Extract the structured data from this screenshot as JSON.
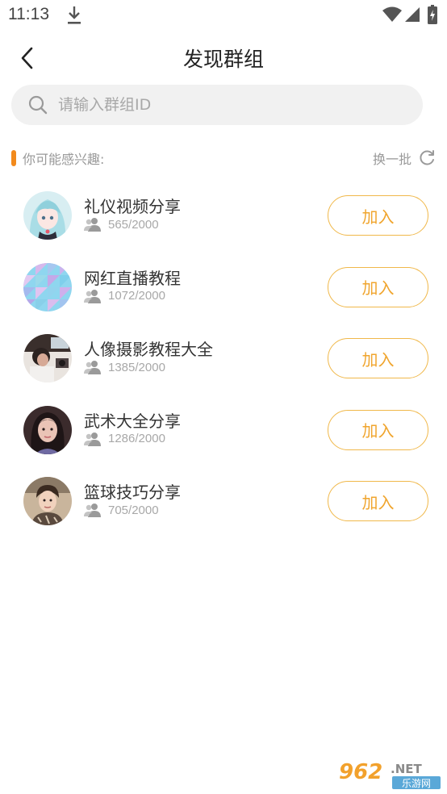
{
  "status_bar": {
    "time": "11:13"
  },
  "nav": {
    "title": "发现群组",
    "back_icon": "chevron-left-icon"
  },
  "search": {
    "placeholder": "请输入群组ID",
    "value": ""
  },
  "section": {
    "title": "你可能感兴趣:",
    "refresh_label": "换一批",
    "accent_color": "#f28a1c"
  },
  "groups": [
    {
      "name": "礼仪视频分享",
      "members": "565/2000",
      "join_label": "加入"
    },
    {
      "name": "网红直播教程",
      "members": "1072/2000",
      "join_label": "加入"
    },
    {
      "name": "人像摄影教程大全",
      "members": "1385/2000",
      "join_label": "加入"
    },
    {
      "name": "武术大全分享",
      "members": "1286/2000",
      "join_label": "加入"
    },
    {
      "name": "篮球技巧分享",
      "members": "705/2000",
      "join_label": "加入"
    }
  ],
  "colors": {
    "join_border": "#f0b84a",
    "join_text": "#f0a52e"
  },
  "watermark": {
    "number": "962",
    "suffix": ".NET",
    "subtitle": "乐游网"
  }
}
